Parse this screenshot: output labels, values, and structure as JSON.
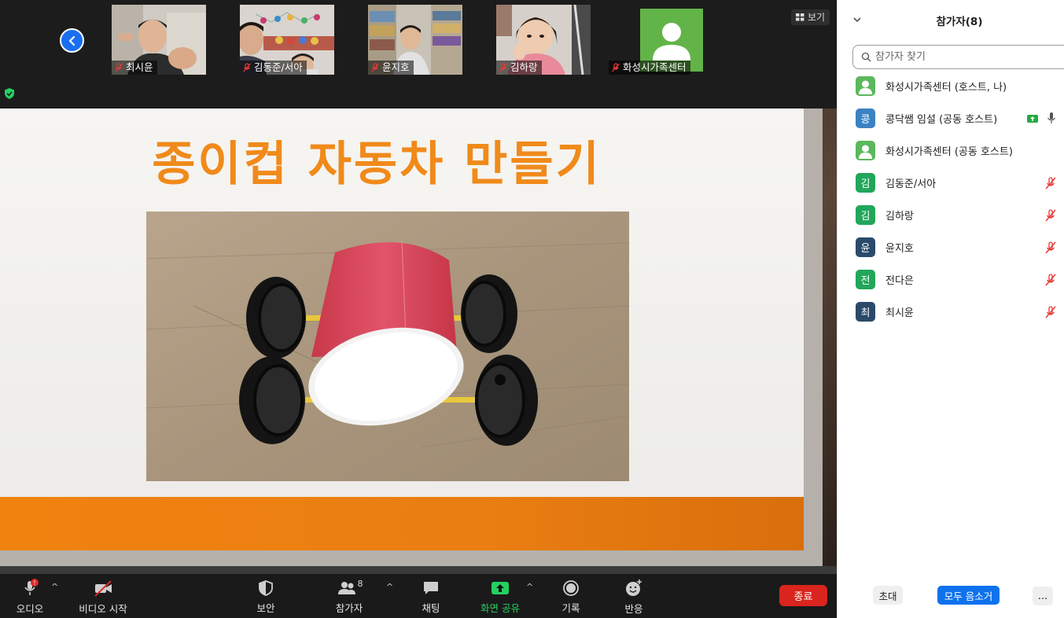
{
  "view_button": {
    "label": "보기"
  },
  "thumbnails": [
    {
      "name": "최시윤",
      "scene": "boy-room"
    },
    {
      "name": "김동준/서아",
      "scene": "balloons"
    },
    {
      "name": "윤지호",
      "scene": "bookshelf"
    },
    {
      "name": "김하랑",
      "scene": "girl"
    },
    {
      "name": "화성시가족센터",
      "scene": "avatar"
    }
  ],
  "slide": {
    "title": "종이컵 자동차 만들기"
  },
  "toolbar": {
    "audio": "오디오",
    "video": "비디오 시작",
    "security": "보안",
    "participants": "참가자",
    "participants_count": "8",
    "chat": "채팅",
    "share": "화면 공유",
    "record": "기록",
    "reactions": "반응",
    "end": "종료"
  },
  "panel": {
    "title": "참가자(8)",
    "search_placeholder": "참가자 찾기",
    "participants": [
      {
        "initial": "",
        "name": "화성시가족센터 (호스트, 나)",
        "avatar_color": "#5cb85c",
        "is_photo": true,
        "mic": "none"
      },
      {
        "initial": "콩",
        "name": "콩닥쌤 임설 (공동 호스트)",
        "avatar_color": "#3b82c4",
        "is_photo": false,
        "mic": "on-share"
      },
      {
        "initial": "",
        "name": "화성시가족센터 (공동 호스트)",
        "avatar_color": "#5cb85c",
        "is_photo": true,
        "mic": "none"
      },
      {
        "initial": "김",
        "name": "김동준/서아",
        "avatar_color": "#21a65a",
        "is_photo": false,
        "mic": "muted"
      },
      {
        "initial": "김",
        "name": "김하랑",
        "avatar_color": "#21a65a",
        "is_photo": false,
        "mic": "muted"
      },
      {
        "initial": "윤",
        "name": "윤지호",
        "avatar_color": "#2b4a6b",
        "is_photo": false,
        "mic": "muted"
      },
      {
        "initial": "전",
        "name": "전다은",
        "avatar_color": "#21a65a",
        "is_photo": false,
        "mic": "muted"
      },
      {
        "initial": "최",
        "name": "최시윤",
        "avatar_color": "#2b4a6b",
        "is_photo": false,
        "mic": "muted"
      }
    ],
    "invite": "초대",
    "mute_all": "모두 음소거",
    "more": "..."
  }
}
